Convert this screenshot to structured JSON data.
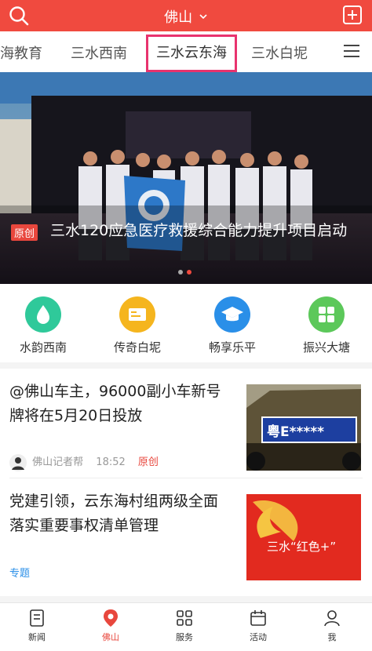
{
  "header": {
    "title": "佛山"
  },
  "tabs": [
    "海教育",
    "三水西南",
    "三水云东海",
    "三水白坭"
  ],
  "banner": {
    "badge": "原创",
    "title": "三水120应急医疗救援综合能力提升项目启动"
  },
  "quick_links": [
    "水韵西南",
    "传奇白坭",
    "畅享乐平",
    "振兴大塘"
  ],
  "news": [
    {
      "title": "@佛山车主，96000副小车新号牌将在5月20日投放",
      "author": "佛山记者帮",
      "time": "18:52",
      "tag": "原创",
      "thumb_text": "粤E*****"
    },
    {
      "title": "党建引领，云东海村组两级全面落实重要事权清单管理",
      "tag": "专题",
      "thumb_text": "三水“红色+”"
    }
  ],
  "bottom_nav": [
    "新闻",
    "佛山",
    "服务",
    "活动",
    "我"
  ],
  "colors": {
    "brand": "#f04a3f",
    "highlight_border": "#e8336e"
  }
}
